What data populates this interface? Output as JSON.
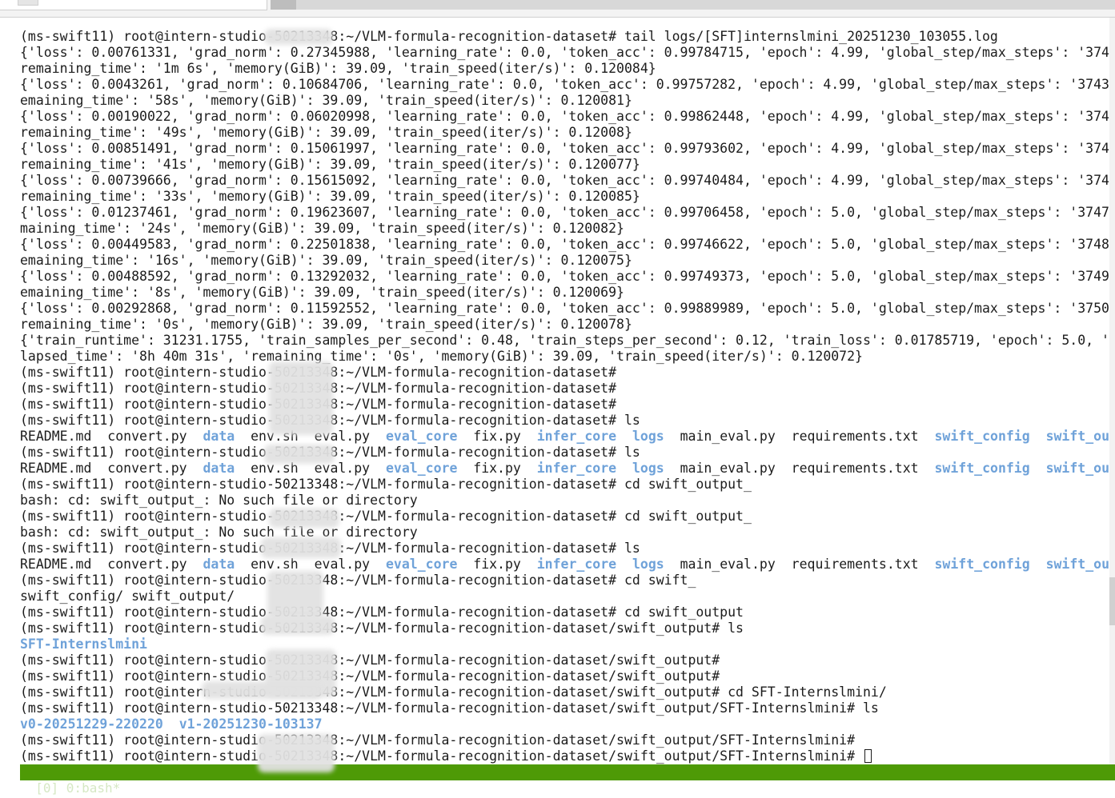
{
  "terminal": {
    "lines": [
      [
        {
          "text": "(ms-swift11) root@intern-studio-50213348:~/VLM-formula-recognition-dataset# tail logs/[SFT]internslmini_20251230_103055.log"
        }
      ],
      [
        {
          "text": "{'loss': 0.00761331, 'grad_norm': 0.27345988, 'learning_rate': 0.0, 'token_acc': 0.99784715, 'epoch': 4.99, 'global_step/max_steps': '374"
        }
      ],
      [
        {
          "text": "remaining_time': '1m 6s', 'memory(GiB)': 39.09, 'train_speed(iter/s)': 0.120084}"
        }
      ],
      [
        {
          "text": "{'loss': 0.0043261, 'grad_norm': 0.10684706, 'learning_rate': 0.0, 'token_acc': 0.99757282, 'epoch': 4.99, 'global_step/max_steps': '3743"
        }
      ],
      [
        {
          "text": "emaining_time': '58s', 'memory(GiB)': 39.09, 'train_speed(iter/s)': 0.120081}"
        }
      ],
      [
        {
          "text": "{'loss': 0.00190022, 'grad_norm': 0.06020998, 'learning_rate': 0.0, 'token_acc': 0.99862448, 'epoch': 4.99, 'global_step/max_steps': '374"
        }
      ],
      [
        {
          "text": "remaining_time': '49s', 'memory(GiB)': 39.09, 'train_speed(iter/s)': 0.12008}"
        }
      ],
      [
        {
          "text": "{'loss': 0.00851491, 'grad_norm': 0.15061997, 'learning_rate': 0.0, 'token_acc': 0.99793602, 'epoch': 4.99, 'global_step/max_steps': '374"
        }
      ],
      [
        {
          "text": "remaining_time': '41s', 'memory(GiB)': 39.09, 'train_speed(iter/s)': 0.120077}"
        }
      ],
      [
        {
          "text": "{'loss': 0.00739666, 'grad_norm': 0.15615092, 'learning_rate': 0.0, 'token_acc': 0.99740484, 'epoch': 4.99, 'global_step/max_steps': '374"
        }
      ],
      [
        {
          "text": "remaining_time': '33s', 'memory(GiB)': 39.09, 'train_speed(iter/s)': 0.120085}"
        }
      ],
      [
        {
          "text": "{'loss': 0.01237461, 'grad_norm': 0.19623607, 'learning_rate': 0.0, 'token_acc': 0.99706458, 'epoch': 5.0, 'global_step/max_steps': '3747"
        }
      ],
      [
        {
          "text": "maining_time': '24s', 'memory(GiB)': 39.09, 'train_speed(iter/s)': 0.120082}"
        }
      ],
      [
        {
          "text": "{'loss': 0.00449583, 'grad_norm': 0.22501838, 'learning_rate': 0.0, 'token_acc': 0.99746622, 'epoch': 5.0, 'global_step/max_steps': '3748"
        }
      ],
      [
        {
          "text": "emaining_time': '16s', 'memory(GiB)': 39.09, 'train_speed(iter/s)': 0.120075}"
        }
      ],
      [
        {
          "text": "{'loss': 0.00488592, 'grad_norm': 0.13292032, 'learning_rate': 0.0, 'token_acc': 0.99749373, 'epoch': 5.0, 'global_step/max_steps': '3749"
        }
      ],
      [
        {
          "text": "emaining_time': '8s', 'memory(GiB)': 39.09, 'train_speed(iter/s)': 0.120069}"
        }
      ],
      [
        {
          "text": "{'loss': 0.00292868, 'grad_norm': 0.11592552, 'learning_rate': 0.0, 'token_acc': 0.99889989, 'epoch': 5.0, 'global_step/max_steps': '3750"
        }
      ],
      [
        {
          "text": "remaining_time': '0s', 'memory(GiB)': 39.09, 'train_speed(iter/s)': 0.120078}"
        }
      ],
      [
        {
          "text": "{'train_runtime': 31231.1755, 'train_samples_per_second': 0.48, 'train_steps_per_second': 0.12, 'train_loss': 0.01785719, 'epoch': 5.0, '"
        }
      ],
      [
        {
          "text": "lapsed_time': '8h 40m 31s', 'remaining_time': '0s', 'memory(GiB)': 39.09, 'train_speed(iter/s)': 0.120072}"
        }
      ],
      [
        {
          "text": "(ms-swift11) root@intern-studio-50213348:~/VLM-formula-recognition-dataset#"
        }
      ],
      [
        {
          "text": "(ms-swift11) root@intern-studio-50213348:~/VLM-formula-recognition-dataset#"
        }
      ],
      [
        {
          "text": "(ms-swift11) root@intern-studio-50213348:~/VLM-formula-recognition-dataset#"
        }
      ],
      [
        {
          "text": "(ms-swift11) root@intern-studio-50213348:~/VLM-formula-recognition-dataset# ls"
        }
      ],
      [
        {
          "text": "README.md  convert.py  "
        },
        {
          "text": "data",
          "dir": true
        },
        {
          "text": "  env.sh  eval.py  "
        },
        {
          "text": "eval_core",
          "dir": true
        },
        {
          "text": "  fix.py  "
        },
        {
          "text": "infer_core",
          "dir": true
        },
        {
          "text": "  "
        },
        {
          "text": "logs",
          "dir": true
        },
        {
          "text": "  main_eval.py  requirements.txt  "
        },
        {
          "text": "swift_config",
          "dir": true
        },
        {
          "text": "  "
        },
        {
          "text": "swift_output",
          "dir": true
        }
      ],
      [
        {
          "text": "(ms-swift11) root@intern-studio-50213348:~/VLM-formula-recognition-dataset# ls"
        }
      ],
      [
        {
          "text": "README.md  convert.py  "
        },
        {
          "text": "data",
          "dir": true
        },
        {
          "text": "  env.sh  eval.py  "
        },
        {
          "text": "eval_core",
          "dir": true
        },
        {
          "text": "  fix.py  "
        },
        {
          "text": "infer_core",
          "dir": true
        },
        {
          "text": "  "
        },
        {
          "text": "logs",
          "dir": true
        },
        {
          "text": "  main_eval.py  requirements.txt  "
        },
        {
          "text": "swift_config",
          "dir": true
        },
        {
          "text": "  "
        },
        {
          "text": "swift_output",
          "dir": true
        }
      ],
      [
        {
          "text": "(ms-swift11) root@intern-studio-50213348:~/VLM-formula-recognition-dataset# cd swift_output_"
        }
      ],
      [
        {
          "text": "bash: cd: swift_output_: No such file or directory"
        }
      ],
      [
        {
          "text": "(ms-swift11) root@intern-studio-50213348:~/VLM-formula-recognition-dataset# cd swift_output_"
        }
      ],
      [
        {
          "text": "bash: cd: swift_output_: No such file or directory"
        }
      ],
      [
        {
          "text": "(ms-swift11) root@intern-studio-50213348:~/VLM-formula-recognition-dataset# ls"
        }
      ],
      [
        {
          "text": "README.md  convert.py  "
        },
        {
          "text": "data",
          "dir": true
        },
        {
          "text": "  env.sh  eval.py  "
        },
        {
          "text": "eval_core",
          "dir": true
        },
        {
          "text": "  fix.py  "
        },
        {
          "text": "infer_core",
          "dir": true
        },
        {
          "text": "  "
        },
        {
          "text": "logs",
          "dir": true
        },
        {
          "text": "  main_eval.py  requirements.txt  "
        },
        {
          "text": "swift_config",
          "dir": true
        },
        {
          "text": "  "
        },
        {
          "text": "swift_output",
          "dir": true
        }
      ],
      [
        {
          "text": "(ms-swift11) root@intern-studio-50213348:~/VLM-formula-recognition-dataset# cd swift_"
        }
      ],
      [
        {
          "text": "swift_config/ swift_output/"
        }
      ],
      [
        {
          "text": "(ms-swift11) root@intern-studio-50213348:~/VLM-formula-recognition-dataset# cd swift_output"
        }
      ],
      [
        {
          "text": "(ms-swift11) root@intern-studio-50213348:~/VLM-formula-recognition-dataset/swift_output# ls"
        }
      ],
      [
        {
          "text": "SFT-Internslmini",
          "dir": true
        }
      ],
      [
        {
          "text": "(ms-swift11) root@intern-studio-50213348:~/VLM-formula-recognition-dataset/swift_output#"
        }
      ],
      [
        {
          "text": "(ms-swift11) root@intern-studio-50213348:~/VLM-formula-recognition-dataset/swift_output#"
        }
      ],
      [
        {
          "text": "(ms-swift11) root@intern-studio-50213348:~/VLM-formula-recognition-dataset/swift_output# cd SFT-Internslmini/"
        }
      ],
      [
        {
          "text": "(ms-swift11) root@intern-studio-50213348:~/VLM-formula-recognition-dataset/swift_output/SFT-Internslmini# ls"
        }
      ],
      [
        {
          "text": "v0-20251229-220220",
          "dir": true
        },
        {
          "text": "  "
        },
        {
          "text": "v1-20251230-103137",
          "dir": true
        }
      ],
      [
        {
          "text": "(ms-swift11) root@intern-studio-50213348:~/VLM-formula-recognition-dataset/swift_output/SFT-Internslmini#"
        }
      ],
      [
        {
          "text": "(ms-swift11) root@intern-studio-50213348:~/VLM-formula-recognition-dataset/swift_output/SFT-Internslmini# "
        }
      ]
    ]
  },
  "statusbar": {
    "text": "[0] 0:bash*"
  },
  "colors": {
    "text": "#1c1c1c",
    "directory": "#6fa2d9",
    "statusbar_bg": "#4e9a06",
    "statusbar_text": "#d6e8c4"
  }
}
